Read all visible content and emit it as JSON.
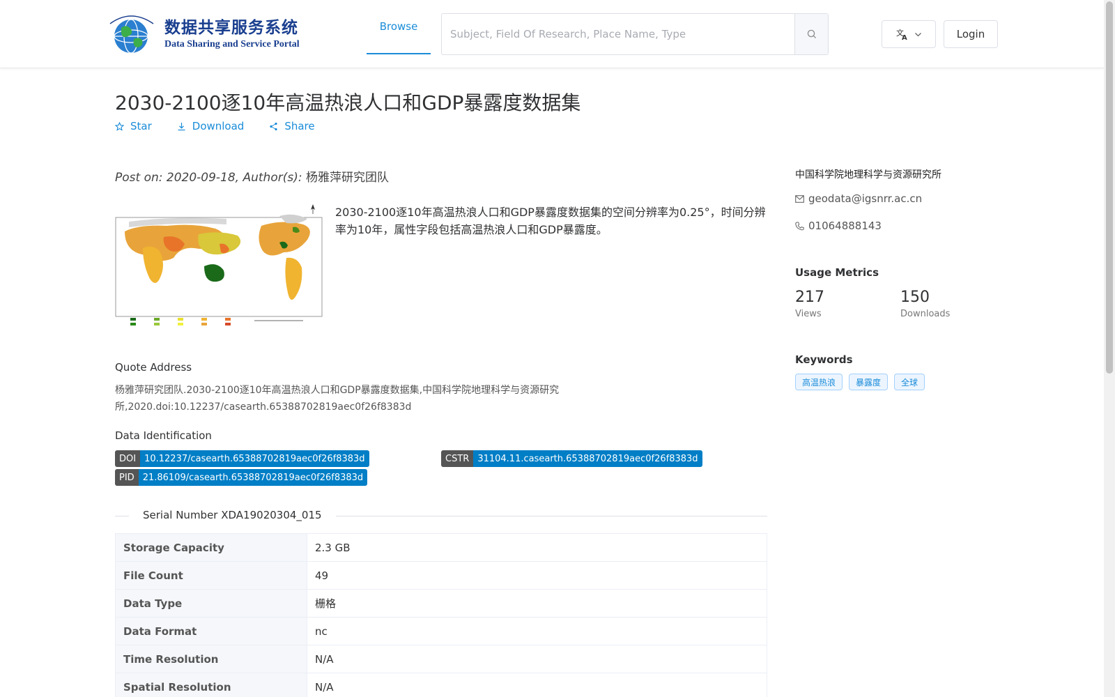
{
  "header": {
    "logo_cn": "数据共享服务系统",
    "logo_en": "Data Sharing and Service Portal",
    "nav_browse": "Browse",
    "search_placeholder": "Subject, Field Of Research, Place Name, Type",
    "login": "Login"
  },
  "dataset": {
    "title": "2030-2100逐10年高温热浪人口和GDP暴露度数据集",
    "actions": {
      "star": "Star",
      "download": "Download",
      "share": "Share"
    },
    "post_prefix": "Post on: 2020-09-18, Author(s):",
    "author": "杨雅萍研究团队",
    "description": "2030-2100逐10年高温热浪人口和GDP暴露度数据集的空间分辨率为0.25°，时间分辨率为10年，属性字段包括高温热浪人口和GDP暴露度。",
    "quote_label": "Quote Address",
    "quote_text": "杨雅萍研究团队.2030-2100逐10年高温热浪人口和GDP暴露度数据集,中国科学院地理科学与资源研究所,2020.doi:10.12237/casearth.65388702819aec0f26f8383d",
    "ident_label": "Data Identification",
    "ids": {
      "doi_key": "DOI",
      "doi_value": "10.12237/casearth.65388702819aec0f26f8383d",
      "cstr_key": "CSTR",
      "cstr_value": "31104.11.casearth.65388702819aec0f26f8383d",
      "pid_key": "PID",
      "pid_value": "21.86109/casearth.65388702819aec0f26f8383d"
    },
    "serial": "Serial Number XDA19020304_015",
    "info_rows": [
      {
        "key": "Storage Capacity",
        "value": "2.3 GB"
      },
      {
        "key": "File Count",
        "value": "49"
      },
      {
        "key": "Data Type",
        "value": "栅格"
      },
      {
        "key": "Data Format",
        "value": "nc"
      },
      {
        "key": "Time Resolution",
        "value": "N/A"
      },
      {
        "key": "Spatial Resolution",
        "value": "N/A"
      }
    ]
  },
  "sidebar": {
    "org": "中国科学院地理科学与资源研究所",
    "email": "geodata@igsnrr.ac.cn",
    "phone": "01064888143",
    "metrics_title": "Usage Metrics",
    "views_value": "217",
    "views_label": "Views",
    "downloads_value": "150",
    "downloads_label": "Downloads",
    "keywords_title": "Keywords",
    "keywords": [
      "高温热浪",
      "暴露度",
      "全球"
    ]
  },
  "colors": {
    "accent": "#1a8cd8",
    "badge_key": "#555555",
    "badge_value": "#007ec6",
    "logo": "#1a3f8f"
  },
  "icons": {
    "star": "star-icon",
    "download": "download-icon",
    "share": "share-icon",
    "search": "search-icon",
    "language": "translate-icon",
    "email": "mail-icon",
    "phone": "phone-icon"
  }
}
